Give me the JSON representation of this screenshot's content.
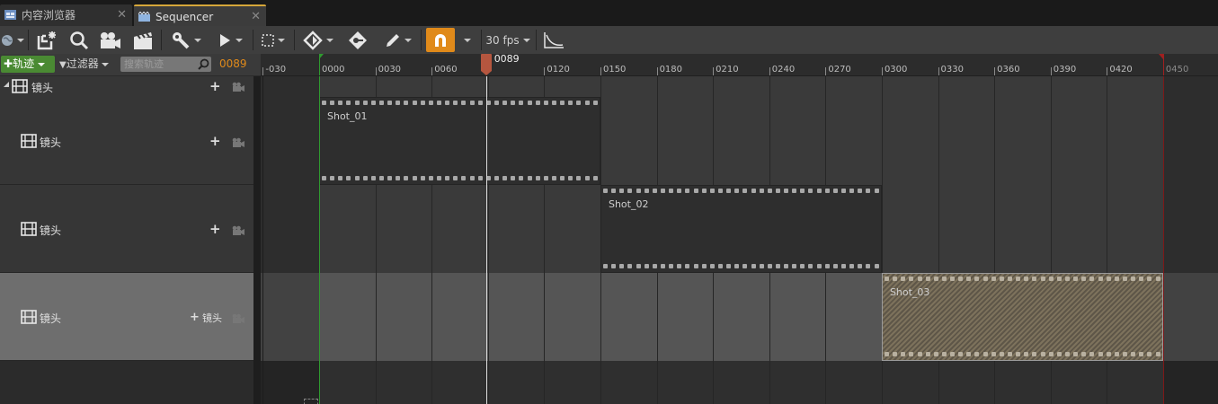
{
  "tabs": [
    {
      "label": "内容浏览器",
      "icon": "content-browser-icon",
      "active": false
    },
    {
      "label": "Sequencer",
      "icon": "sequencer-icon",
      "active": true
    }
  ],
  "tab_close": "✕",
  "toolbar": {
    "fps_label": "30 fps",
    "buttons": [
      "world-icon",
      "save-icon",
      "find-icon",
      "camera-icon",
      "clapper-icon",
      "tools-icon",
      "play-icon",
      "selection-icon",
      "key-icon",
      "autokey-icon",
      "pencil-icon",
      "snap-icon",
      "curve-editor-icon"
    ]
  },
  "filter_bar": {
    "add_track": "轨迹",
    "filter": "过滤器",
    "search_placeholder": "搜索轨迹",
    "current_frame": "0089"
  },
  "ruler": {
    "labels": [
      "-030",
      "0000",
      "0030",
      "0060",
      "0120",
      "0150",
      "0180",
      "0210",
      "0240",
      "0270",
      "0300",
      "0330",
      "0360",
      "0390",
      "0420",
      "0450"
    ],
    "playhead_label": "0089",
    "playhead_frame": 89
  },
  "tree": {
    "root": {
      "label": "镜头"
    },
    "rows": [
      {
        "label": "镜头",
        "add_label": ""
      },
      {
        "label": "镜头",
        "add_label": ""
      },
      {
        "label": "镜头",
        "add_label": "镜头"
      }
    ]
  },
  "plus_glyph": "+",
  "shots": [
    {
      "name": "Shot_01",
      "start": 0,
      "end": 150
    },
    {
      "name": "Shot_02",
      "start": 150,
      "end": 300
    },
    {
      "name": "Shot_03",
      "start": 300,
      "end": 450
    }
  ],
  "colors": {
    "start_marker": "#2f9a2f",
    "end_marker": "#a02020",
    "playhead": "#b5563f",
    "accent": "#e08a1a"
  }
}
